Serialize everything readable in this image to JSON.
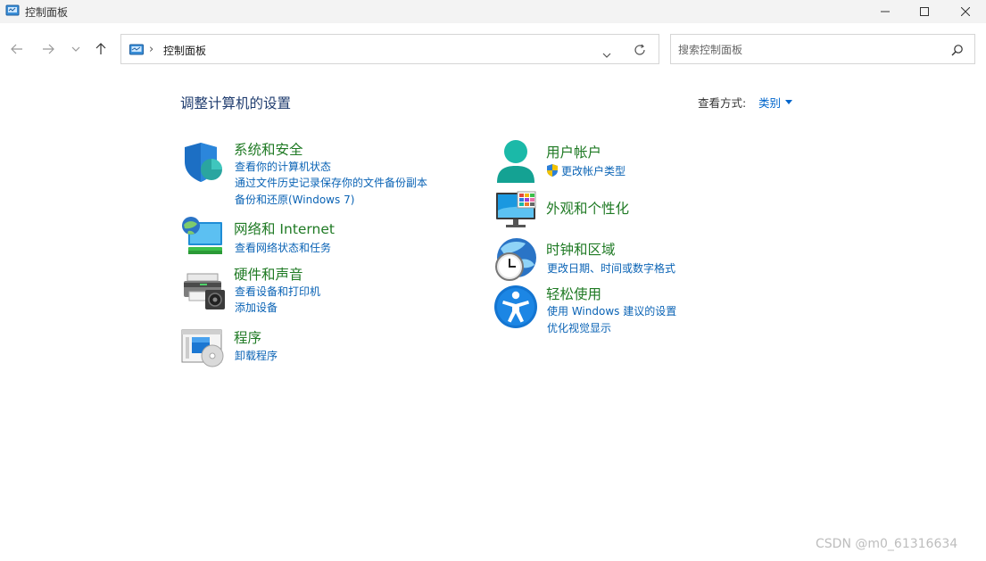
{
  "window": {
    "title": "控制面板"
  },
  "address_bar": {
    "breadcrumb": "控制面板",
    "separator": "›"
  },
  "search": {
    "placeholder": "搜索控制面板"
  },
  "header": {
    "title": "调整计算机的设置",
    "view_by_label": "查看方式:",
    "view_by_value": "类别"
  },
  "categories": {
    "system_security": {
      "title": "系统和安全",
      "links": [
        "查看你的计算机状态",
        "通过文件历史记录保存你的文件备份副本",
        "备份和还原(Windows 7)"
      ]
    },
    "network": {
      "title": "网络和 Internet",
      "links": [
        "查看网络状态和任务"
      ]
    },
    "hardware": {
      "title": "硬件和声音",
      "links": [
        "查看设备和打印机",
        "添加设备"
      ]
    },
    "programs": {
      "title": "程序",
      "links": [
        "卸载程序"
      ]
    },
    "user_accounts": {
      "title": "用户帐户",
      "links": [
        "更改帐户类型"
      ]
    },
    "appearance": {
      "title": "外观和个性化",
      "links": []
    },
    "clock_region": {
      "title": "时钟和区域",
      "links": [
        "更改日期、时间或数字格式"
      ]
    },
    "ease_of_access": {
      "title": "轻松使用",
      "links": [
        "使用 Windows 建议的设置",
        "优化视觉显示"
      ]
    }
  },
  "watermark": "CSDN @m0_61316634",
  "colors": {
    "category_title": "#1f7a24",
    "link": "#0a63b5",
    "page_title": "#1e3b6e",
    "titlebar_bg": "#f3f3f3"
  }
}
